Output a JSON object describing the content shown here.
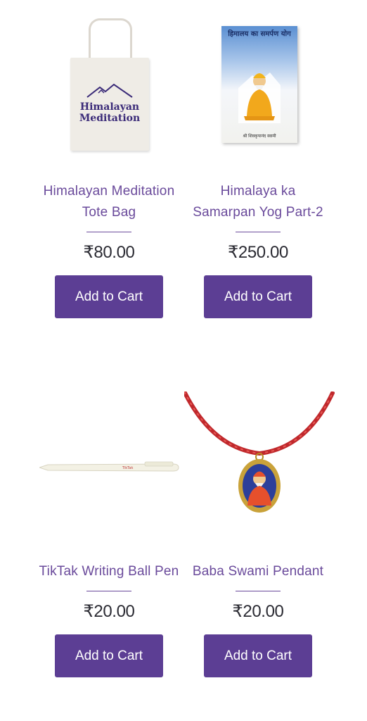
{
  "products": [
    {
      "name": "Himalayan Meditation Tote Bag",
      "price": "₹80.00",
      "button": "Add to Cart",
      "tote_text": "Himalayan Meditation"
    },
    {
      "name": "Himalaya ka Samarpan Yog Part-2",
      "price": "₹250.00",
      "button": "Add to Cart",
      "book_title": "हिमालय का समर्पण योग",
      "book_author": "श्री शिवकृपानंद स्वामी"
    },
    {
      "name": "TikTak Writing Ball Pen",
      "price": "₹20.00",
      "button": "Add to Cart",
      "pen_brand": "TikTak"
    },
    {
      "name": "Baba Swami Pendant",
      "price": "₹20.00",
      "button": "Add to Cart"
    }
  ],
  "colors": {
    "accent": "#5c3e94",
    "name_text": "#6a4a9b",
    "price_text": "#2b2b33"
  }
}
